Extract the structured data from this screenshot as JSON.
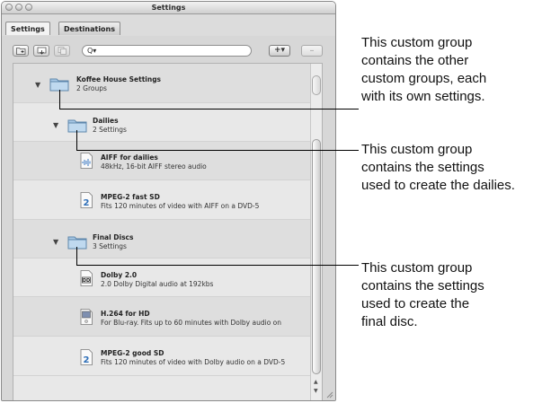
{
  "window": {
    "title": "Settings",
    "tabs": [
      {
        "label": "Settings",
        "active": true
      },
      {
        "label": "Destinations",
        "active": false
      }
    ],
    "toolbar": {
      "buttons": [
        "new-group-icon",
        "apply-icon",
        "duplicate-icon"
      ],
      "search_value": "Q▾",
      "add_label": "+▾",
      "remove_label": "–"
    }
  },
  "tree": {
    "koffee": {
      "name": "Koffee House Settings",
      "desc": "2 Groups"
    },
    "dailies": {
      "name": "Dailies",
      "desc": "2 Settings"
    },
    "aiff": {
      "name": "AIFF for dailies",
      "desc": "48kHz, 16-bit AIFF stereo audio"
    },
    "mpeg_fast": {
      "name": "MPEG-2 fast SD",
      "desc": "Fits 120 minutes of video with AIFF on a DVD-5"
    },
    "final": {
      "name": "Final Discs",
      "desc": "3 Settings"
    },
    "dolby": {
      "name": "Dolby 2.0",
      "desc": "2.0 Dolby Digital audio at 192kbs"
    },
    "h264": {
      "name": "H.264 for HD",
      "desc": "For Blu-ray. Fits up to 60 minutes  with Dolby audio on"
    },
    "mpeg_good": {
      "name": "MPEG-2 good SD",
      "desc": "Fits 120 minutes of video with Dolby audio on a DVD-5"
    }
  },
  "callouts": [
    "This custom group\ncontains the other\ncustom groups, each\nwith its own settings.",
    "This custom group\ncontains the settings\nused to create the dailies.",
    "This custom group\ncontains the settings\nused to create the\nfinal disc."
  ]
}
